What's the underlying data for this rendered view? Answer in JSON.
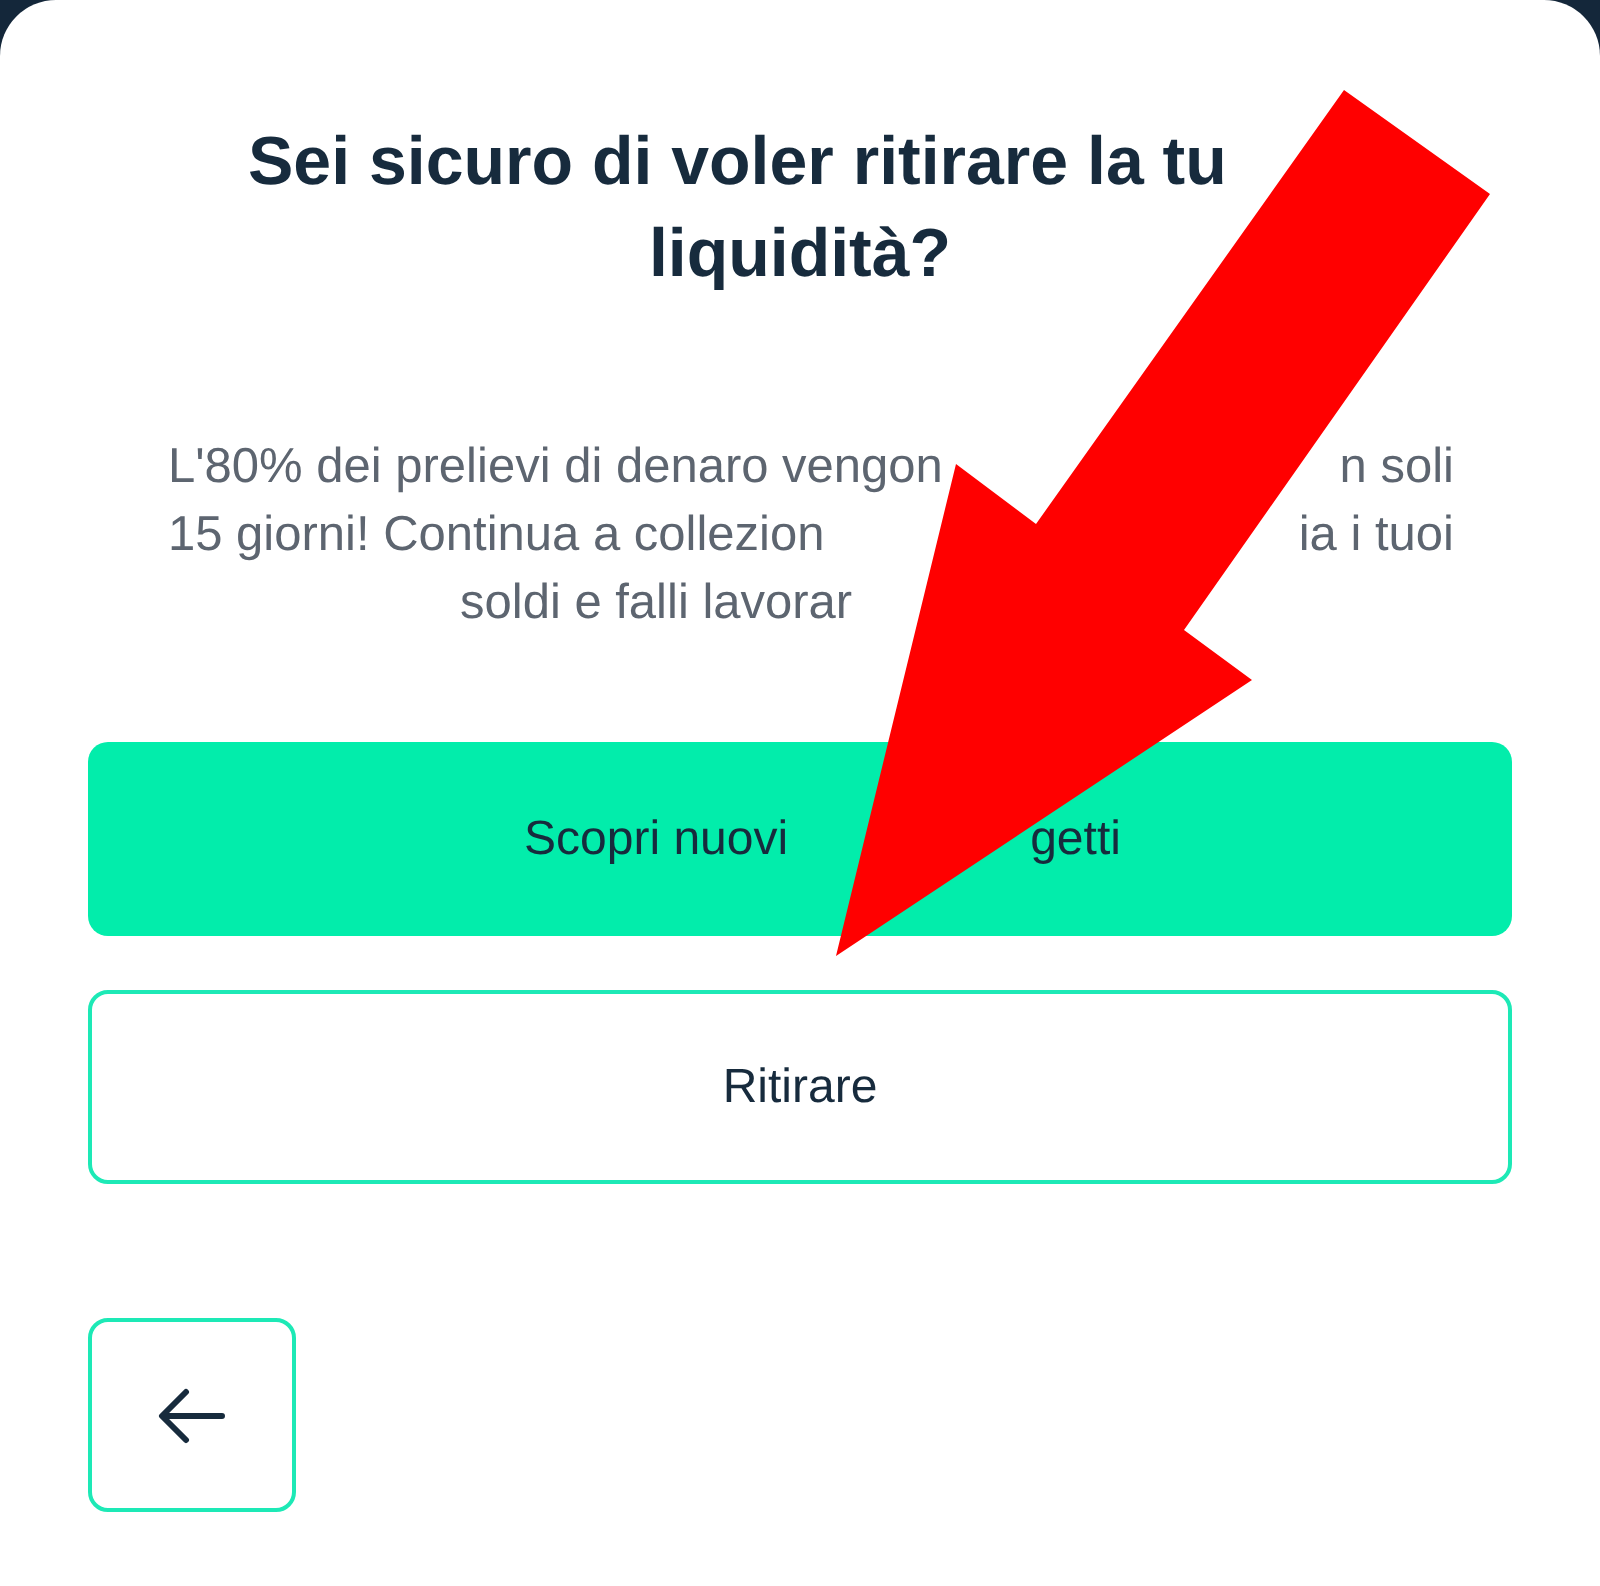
{
  "dialog": {
    "title_lines": [
      [
        "Sei sicuro di voler ritirare la tu"
      ],
      [
        "liquidità?"
      ]
    ],
    "message_lines": [
      [
        "L'80% dei prelievi di denaro vengon",
        "n soli"
      ],
      [
        "15 giorni! Continua a collezion",
        "ia i tuoi"
      ],
      [
        "soldi e falli lavorar"
      ]
    ],
    "primary_button": [
      "Scopri nuovi",
      "getti"
    ],
    "secondary_button": "Ritirare"
  }
}
